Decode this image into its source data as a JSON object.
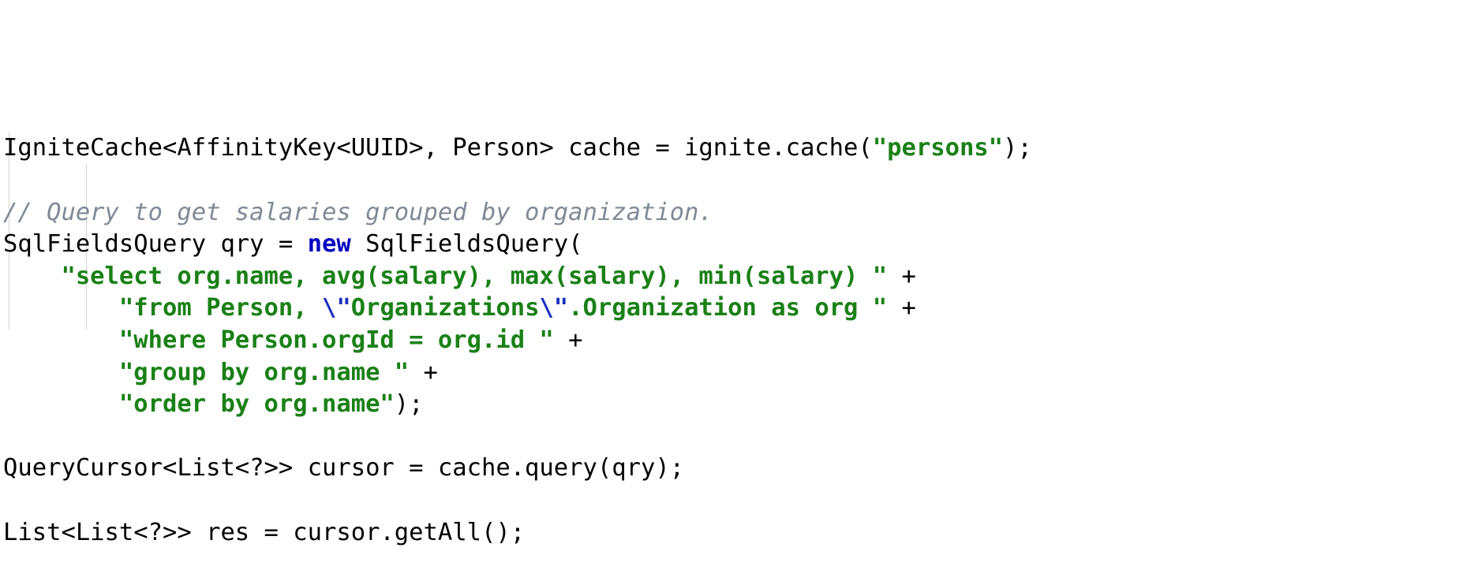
{
  "editor": {
    "language": "Java",
    "background_color": "#ffffff",
    "colors": {
      "plain": "#000000",
      "string": "#1a8017",
      "keyword": "#0000c0",
      "escape": "#1a2fc0",
      "comment": "#808a96",
      "indent_guide": "#d4d4d4"
    }
  },
  "code": {
    "full_text": "IgniteCache<AffinityKey<UUID>, Person> cache = ignite.cache(\"persons\");\n\n// Query to get salaries grouped by organization.\nSqlFieldsQuery qry = new SqlFieldsQuery(\n    \"select org.name, avg(salary), max(salary), min(salary) \" +\n        \"from Person, \\\"Organizations\\\".Organization as org \" +\n        \"where Person.orgId = org.id \" +\n        \"group by org.name \" +\n        \"order by org.name\");\n\nQueryCursor<List<?>> cursor = cache.query(qry);\n\nList<List<?>> res = cursor.getAll();",
    "lines": [
      {
        "id": "line-1",
        "tokens": [
          {
            "t": "IgniteCache<AffinityKey<UUID>, Person> cache = ignite.cache(",
            "c": "plain"
          },
          {
            "t": "\"persons\"",
            "c": "string"
          },
          {
            "t": ");",
            "c": "plain"
          }
        ]
      },
      {
        "id": "line-2",
        "tokens": []
      },
      {
        "id": "line-3",
        "tokens": [
          {
            "t": "// Query to get salaries grouped by organization.",
            "c": "comment"
          }
        ]
      },
      {
        "id": "line-4",
        "tokens": [
          {
            "t": "SqlFieldsQuery qry = ",
            "c": "plain"
          },
          {
            "t": "new",
            "c": "keyword"
          },
          {
            "t": " SqlFieldsQuery(",
            "c": "plain"
          }
        ]
      },
      {
        "id": "line-5",
        "tokens": [
          {
            "t": "    ",
            "c": "plain"
          },
          {
            "t": "\"select org.name, avg(salary), max(salary), min(salary) \"",
            "c": "string"
          },
          {
            "t": " +",
            "c": "plain"
          }
        ]
      },
      {
        "id": "line-6",
        "tokens": [
          {
            "t": "        ",
            "c": "plain"
          },
          {
            "t": "\"from Person, ",
            "c": "string"
          },
          {
            "t": "\\\"",
            "c": "escape"
          },
          {
            "t": "Organizations",
            "c": "string"
          },
          {
            "t": "\\\"",
            "c": "escape"
          },
          {
            "t": ".Organization as org \"",
            "c": "string"
          },
          {
            "t": " +",
            "c": "plain"
          }
        ]
      },
      {
        "id": "line-7",
        "tokens": [
          {
            "t": "        ",
            "c": "plain"
          },
          {
            "t": "\"where Person.orgId = org.id \"",
            "c": "string"
          },
          {
            "t": " +",
            "c": "plain"
          }
        ]
      },
      {
        "id": "line-8",
        "tokens": [
          {
            "t": "        ",
            "c": "plain"
          },
          {
            "t": "\"group by org.name \"",
            "c": "string"
          },
          {
            "t": " +",
            "c": "plain"
          }
        ]
      },
      {
        "id": "line-9",
        "tokens": [
          {
            "t": "        ",
            "c": "plain"
          },
          {
            "t": "\"order by org.name\"",
            "c": "string"
          },
          {
            "t": ");",
            "c": "plain"
          }
        ]
      },
      {
        "id": "line-10",
        "tokens": []
      },
      {
        "id": "line-11",
        "tokens": [
          {
            "t": "QueryCursor<List<?>> cursor = cache.query(qry);",
            "c": "plain"
          }
        ]
      },
      {
        "id": "line-12",
        "tokens": []
      },
      {
        "id": "line-13",
        "tokens": [
          {
            "t": "List<List<?>> res = cursor.getAll();",
            "c": "plain"
          }
        ]
      }
    ]
  }
}
